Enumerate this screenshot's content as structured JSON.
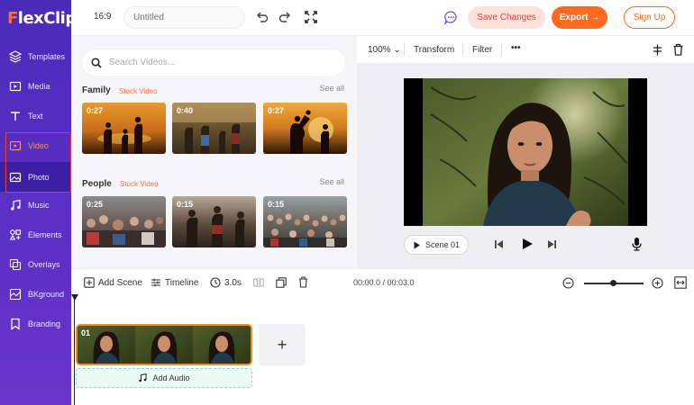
{
  "app": {
    "logo": "FlexClip"
  },
  "sidebar": {
    "items": [
      {
        "label": "Templates",
        "icon": "layers-icon"
      },
      {
        "label": "Media",
        "icon": "media-icon"
      },
      {
        "label": "Text",
        "icon": "text-icon"
      },
      {
        "label": "Video",
        "icon": "video-icon"
      },
      {
        "label": "Photo",
        "icon": "photo-icon"
      },
      {
        "label": "Music",
        "icon": "music-icon"
      },
      {
        "label": "Elements",
        "icon": "elements-icon"
      },
      {
        "label": "Overlays",
        "icon": "overlays-icon"
      },
      {
        "label": "BKground",
        "icon": "background-icon"
      },
      {
        "label": "Branding",
        "icon": "branding-icon"
      }
    ]
  },
  "topbar": {
    "ratio": "16:9",
    "title_placeholder": "Untitled",
    "save_label": "Save Changes",
    "export_label": "Export →",
    "signup_label": "Sign Up"
  },
  "media_panel": {
    "search_placeholder": "Search Videos...",
    "sections": [
      {
        "title": "Family",
        "tag": "Stock Video",
        "see_all": "See all",
        "durations": [
          "0:27",
          "0:40",
          "0:27"
        ]
      },
      {
        "title": "People",
        "tag": "Stock Video",
        "see_all": "See all",
        "durations": [
          "0:25",
          "0:15",
          "0:15"
        ]
      }
    ]
  },
  "preview": {
    "zoom": "100%",
    "transform_label": "Transform",
    "filter_label": "Filter",
    "more_label": "•••",
    "scene_label": "Scene  01"
  },
  "timeline": {
    "add_scene_label": "Add Scene",
    "timeline_label": "Timeline",
    "duration_label": "3.0s",
    "timecode": "00:00.0 / 00:03.0",
    "clip_number": "01",
    "add_audio_label": "Add Audio",
    "add_label": "+"
  },
  "colors": {
    "sidebar_bg": "#5a2fc4",
    "accent_orange": "#ff6a1f",
    "save_bg": "#ffe1dc",
    "selection_red": "#e33a3a",
    "clip_border": "#f08a2c"
  }
}
